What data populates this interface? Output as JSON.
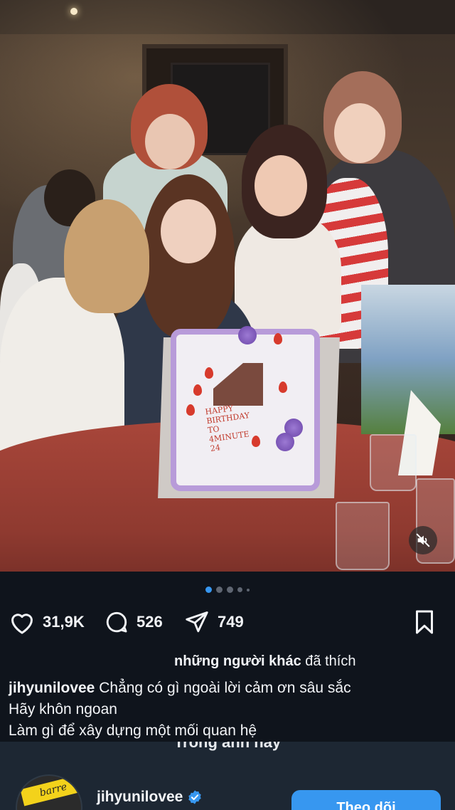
{
  "post": {
    "media": {
      "description_icon": "mute-icon",
      "carousel": {
        "total": 5,
        "active_index": 0
      },
      "cake_text": [
        "HAPPY",
        "BIRTHDAY",
        "TO",
        "4MINUTE",
        "24"
      ]
    },
    "actions": {
      "likes": "31,9K",
      "comments": "526",
      "shares": "749"
    },
    "liked_by": {
      "bold": "những người khác",
      "rest": " đã thích"
    },
    "caption": {
      "username": "jihyunilovee",
      "lines": [
        "Chẳng có gì ngoài lời cảm ơn sâu sắc",
        "Hãy khôn ngoan",
        "Làm gì để xây dựng một mối quan hệ"
      ]
    }
  },
  "sheet": {
    "title": "Trong ảnh này",
    "avatar_sign": "barre",
    "username": "jihyunilovee",
    "follow_label": "Theo dõi"
  },
  "colors": {
    "background": "#0f141c",
    "accent": "#3797f0",
    "sheet": "#1d2733"
  }
}
